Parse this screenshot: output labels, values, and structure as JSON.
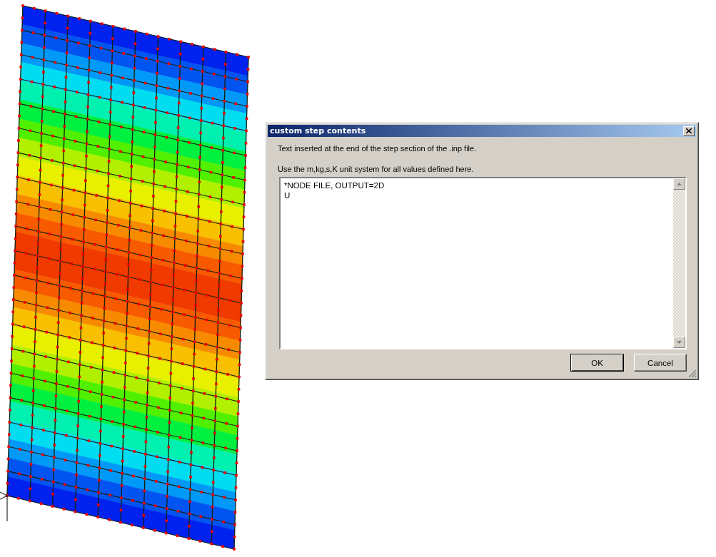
{
  "dialog": {
    "title": "custom step contents",
    "description": "Text inserted at the end of the step section of the .inp file.",
    "units_note": "Use the m,kg,s,K unit system for all values defined here.",
    "text": "*NODE FILE, OUTPUT=2D\nU",
    "buttons": [
      {
        "label": "OK",
        "default": true
      },
      {
        "label": "Cancel",
        "default": false
      }
    ]
  }
}
